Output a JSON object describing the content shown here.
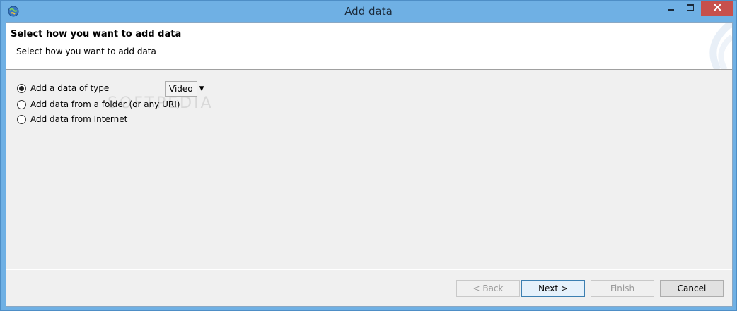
{
  "window": {
    "title": "Add data",
    "icon": "globe-icon",
    "controls": {
      "minimize": "minimize-icon",
      "maximize": "maximize-icon",
      "close": "close-icon"
    }
  },
  "header": {
    "title": "Select how you want to add data",
    "description": "Select how you want to add data"
  },
  "options": [
    {
      "label": "Add a data of type",
      "selected": true
    },
    {
      "label": "Add data from a folder (or any URI)",
      "selected": false
    },
    {
      "label": "Add data from Internet",
      "selected": false
    }
  ],
  "type_select": {
    "value": "Video"
  },
  "watermark": "SOFTPEDIA",
  "buttons": {
    "back": "< Back",
    "next": "Next >",
    "finish": "Finish",
    "cancel": "Cancel"
  },
  "colors": {
    "titlebar": "#6fb0e4",
    "close_button": "#c7504c",
    "client_bg": "#f0f0f0",
    "header_bg": "#ffffff"
  }
}
